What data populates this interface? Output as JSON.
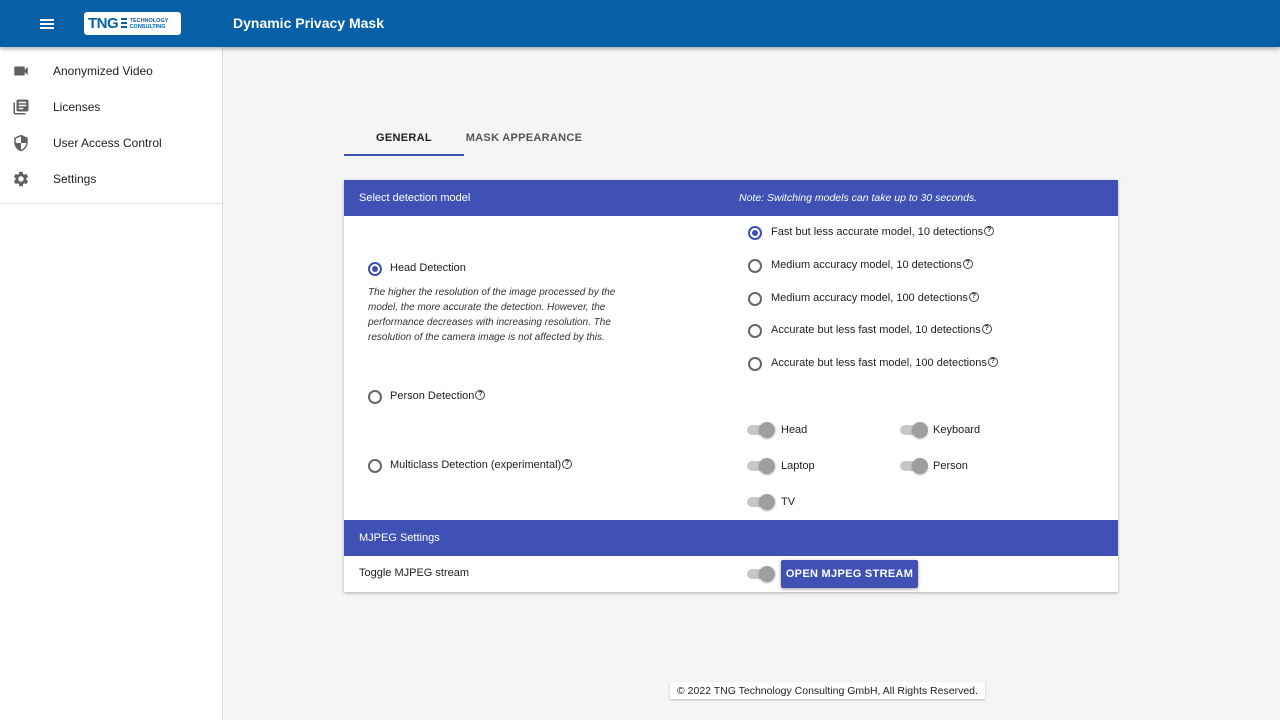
{
  "appbar": {
    "title": "Dynamic Privacy Mask",
    "logo_text": "TNG",
    "logo_sub": "TECHNOLOGY CONSULTING"
  },
  "sidebar": {
    "items": [
      {
        "label": "Anonymized Video",
        "icon": "videocam-icon"
      },
      {
        "label": "Licenses",
        "icon": "library-books-icon"
      },
      {
        "label": "User Access Control",
        "icon": "shield-icon"
      },
      {
        "label": "Settings",
        "icon": "gear-icon"
      }
    ]
  },
  "tabs": [
    {
      "label": "GENERAL",
      "active": true
    },
    {
      "label": "MASK APPEARANCE",
      "active": false
    }
  ],
  "detection": {
    "header": "Select detection model",
    "note": "Note: Switching models can take up to 30 seconds.",
    "types": [
      {
        "label": "Head Detection",
        "checked": true,
        "help": false
      },
      {
        "label": "Person Detection",
        "checked": false,
        "help": true
      },
      {
        "label": "Multiclass Detection (experimental)",
        "checked": false,
        "help": true
      }
    ],
    "head_description": "The higher the resolution of the image processed by the model, the more accurate the detection. However, the performance decreases with increasing resolution. The resolution of the camera image is not affected by this.",
    "models": [
      {
        "label": "Fast but less accurate model, 10 detections",
        "checked": true
      },
      {
        "label": "Medium accuracy model, 10 detections",
        "checked": false
      },
      {
        "label": "Medium accuracy model, 100 detections",
        "checked": false
      },
      {
        "label": "Accurate but less fast model, 10 detections",
        "checked": false
      },
      {
        "label": "Accurate but less fast model, 100 detections",
        "checked": false
      }
    ],
    "classes": [
      {
        "label": "Head"
      },
      {
        "label": "Keyboard"
      },
      {
        "label": "Laptop"
      },
      {
        "label": "Person"
      },
      {
        "label": "TV"
      }
    ]
  },
  "mjpeg": {
    "header": "MJPEG Settings",
    "toggle_label": "Toggle MJPEG stream",
    "button_label": "OPEN MJPEG STREAM"
  },
  "footer": {
    "text": "© 2022 TNG Technology Consulting GmbH, All Rights Reserved."
  },
  "colors": {
    "appbar": "#0560a8",
    "accent": "#3f51b5"
  }
}
